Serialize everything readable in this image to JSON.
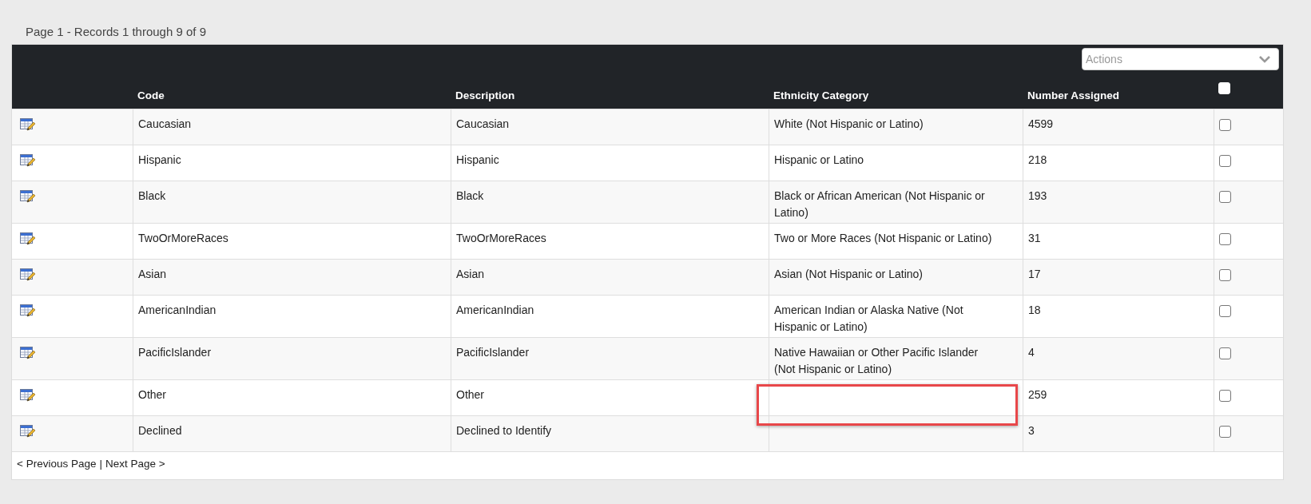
{
  "page_info": "Page 1 - Records 1 through 9 of 9",
  "actions": {
    "placeholder": "Actions"
  },
  "table": {
    "columns": [
      "Code",
      "Description",
      "Ethnicity Category",
      "Number Assigned"
    ],
    "select_all": {
      "checked": false
    },
    "rows": [
      {
        "code": "Caucasian",
        "description": "Caucasian",
        "ethnicity_category": "White (Not Hispanic or Latino)",
        "number_assigned": "4599",
        "checked": false
      },
      {
        "code": "Hispanic",
        "description": "Hispanic",
        "ethnicity_category": "Hispanic or Latino",
        "number_assigned": "218",
        "checked": false
      },
      {
        "code": "Black",
        "description": "Black",
        "ethnicity_category": "Black or African American (Not Hispanic or Latino)",
        "number_assigned": "193",
        "checked": false
      },
      {
        "code": "TwoOrMoreRaces",
        "description": "TwoOrMoreRaces",
        "ethnicity_category": "Two or More Races (Not Hispanic or Latino)",
        "number_assigned": "31",
        "checked": false
      },
      {
        "code": "Asian",
        "description": "Asian",
        "ethnicity_category": "Asian (Not Hispanic or Latino)",
        "number_assigned": "17",
        "checked": false
      },
      {
        "code": "AmericanIndian",
        "description": "AmericanIndian",
        "ethnicity_category": "American Indian or Alaska Native (Not Hispanic or Latino)",
        "number_assigned": "18",
        "checked": false
      },
      {
        "code": "PacificIslander",
        "description": "PacificIslander",
        "ethnicity_category": "Native Hawaiian or Other Pacific Islander (Not Hispanic or Latino)",
        "number_assigned": "4",
        "checked": false
      },
      {
        "code": "Other",
        "description": "Other",
        "number_assigned": "259",
        "checked": false
      },
      {
        "code": "Declined",
        "description": "Declined to Identify",
        "number_assigned": "3",
        "checked": false
      }
    ]
  },
  "pager": {
    "previous": "< Previous Page",
    "separator": "|",
    "next": "Next Page >"
  },
  "annotations": [
    {
      "kind": "rectangle",
      "color": "#e8474a"
    }
  ]
}
